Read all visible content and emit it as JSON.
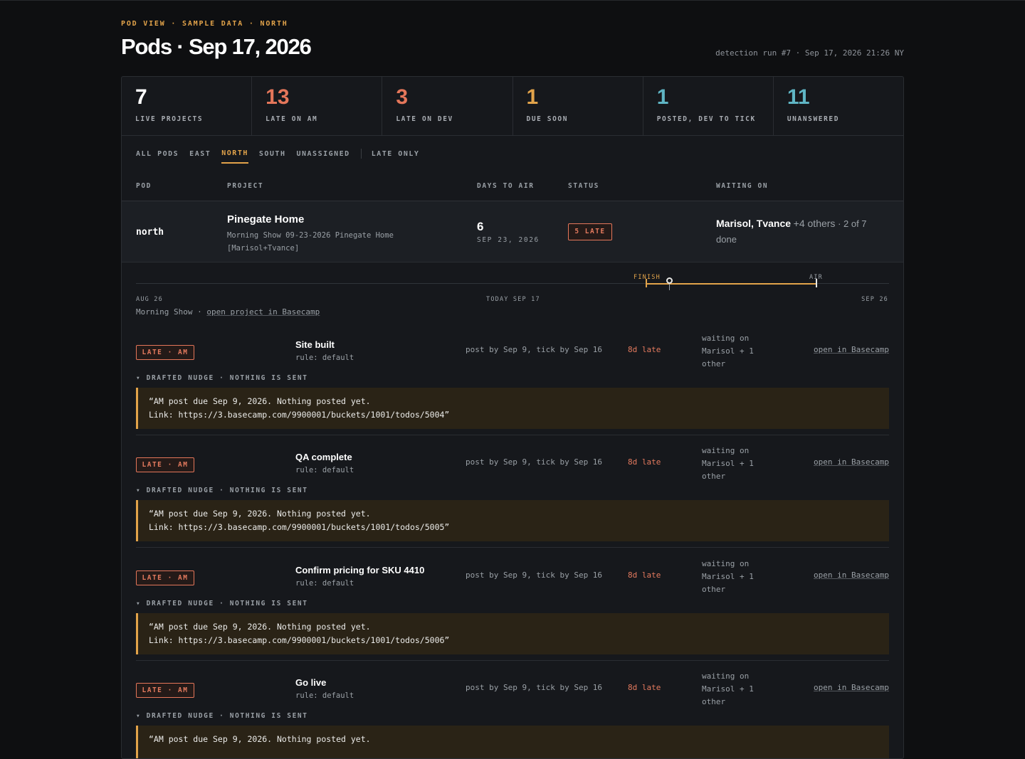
{
  "header": {
    "eyebrow": "POD VIEW · SAMPLE DATA · NORTH",
    "title": "Pods · Sep 17, 2026",
    "run_info": "detection run #7 · Sep 17, 2026 21:26 NY"
  },
  "stats": [
    {
      "value": "7",
      "label": "LIVE PROJECTS",
      "color": "#ffffff"
    },
    {
      "value": "13",
      "label": "LATE ON AM",
      "color": "#e4765a"
    },
    {
      "value": "3",
      "label": "LATE ON DEV",
      "color": "#e4765a"
    },
    {
      "value": "1",
      "label": "DUE SOON",
      "color": "#e2a34a"
    },
    {
      "value": "1",
      "label": "POSTED, DEV TO TICK",
      "color": "#5fb5c4"
    },
    {
      "value": "11",
      "label": "UNANSWERED",
      "color": "#5fb5c4"
    }
  ],
  "filters": {
    "items": [
      "ALL PODS",
      "EAST",
      "NORTH",
      "SOUTH",
      "UNASSIGNED"
    ],
    "active": "NORTH",
    "late_only": "LATE ONLY"
  },
  "table": {
    "headers": {
      "pod": "POD",
      "project": "PROJECT",
      "days": "DAYS TO AIR",
      "status": "STATUS",
      "waiting": "WAITING ON"
    }
  },
  "project": {
    "pod": "north",
    "name": "Pinegate Home",
    "subtitle": "Morning Show 09-23-2026 Pinegate Home [Marisol+Tvance]",
    "days_to_air": "6",
    "air_date": "SEP 23, 2026",
    "status": "5 LATE",
    "waiting_names": "Marisol, Tvance",
    "waiting_others": "+4 others",
    "waiting_progress": "· 2 of 7 done"
  },
  "timeline": {
    "finish_label": "FINISH",
    "air_label": "AIR",
    "start_label": "AUG 26",
    "today_label": "TODAY SEP 17",
    "end_label": "SEP 26",
    "show_name": "Morning Show",
    "separator": "·",
    "project_link": "open project in Basecamp"
  },
  "items": [
    {
      "badge": "LATE · AM",
      "title": "Site built",
      "rule": "rule: default",
      "due": "post by Sep 9, tick by Sep 16",
      "late": "8d late",
      "waiting": "waiting on Marisol + 1 other",
      "open": "open in Basecamp",
      "nudge_header": "▾ DRAFTED NUDGE · NOTHING IS SENT",
      "nudge_text": "“AM post due Sep 9, 2026. Nothing posted yet.\nLink: https://3.basecamp.com/9900001/buckets/1001/todos/5004”"
    },
    {
      "badge": "LATE · AM",
      "title": "QA complete",
      "rule": "rule: default",
      "due": "post by Sep 9, tick by Sep 16",
      "late": "8d late",
      "waiting": "waiting on Marisol + 1 other",
      "open": "open in Basecamp",
      "nudge_header": "▾ DRAFTED NUDGE · NOTHING IS SENT",
      "nudge_text": "“AM post due Sep 9, 2026. Nothing posted yet.\nLink: https://3.basecamp.com/9900001/buckets/1001/todos/5005”"
    },
    {
      "badge": "LATE · AM",
      "title": "Confirm pricing for SKU 4410",
      "rule": "rule: default",
      "due": "post by Sep 9, tick by Sep 16",
      "late": "8d late",
      "waiting": "waiting on Marisol + 1 other",
      "open": "open in Basecamp",
      "nudge_header": "▾ DRAFTED NUDGE · NOTHING IS SENT",
      "nudge_text": "“AM post due Sep 9, 2026. Nothing posted yet.\nLink: https://3.basecamp.com/9900001/buckets/1001/todos/5006”"
    },
    {
      "badge": "LATE · AM",
      "title": "Go live",
      "rule": "rule: default",
      "due": "post by Sep 9, tick by Sep 16",
      "late": "8d late",
      "waiting": "waiting on Marisol + 1 other",
      "open": "open in Basecamp",
      "nudge_header": "▾ DRAFTED NUDGE · NOTHING IS SENT",
      "nudge_text": "“AM post due Sep 9, 2026. Nothing posted yet."
    }
  ]
}
